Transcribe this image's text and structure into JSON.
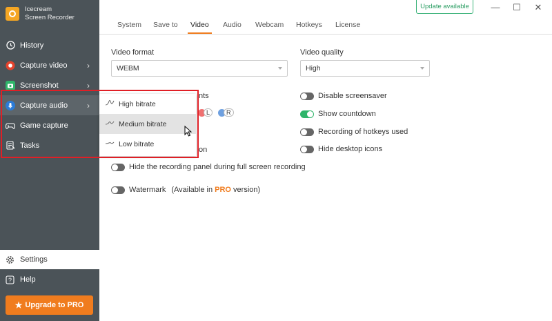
{
  "app": {
    "name_line1": "Icecream",
    "name_line2": "Screen Recorder"
  },
  "sidebar": {
    "items": [
      {
        "label": "History",
        "icon": "history-icon",
        "chevron": false
      },
      {
        "label": "Capture video",
        "icon": "record-icon",
        "chevron": true
      },
      {
        "label": "Screenshot",
        "icon": "camera-icon",
        "chevron": true
      },
      {
        "label": "Capture audio",
        "icon": "microphone-icon",
        "chevron": true
      },
      {
        "label": "Game capture",
        "icon": "gamepad-icon",
        "chevron": false
      },
      {
        "label": "Tasks",
        "icon": "tasks-icon",
        "chevron": false
      }
    ],
    "settings_label": "Settings",
    "help_label": "Help",
    "upgrade_label": "Upgrade to PRO"
  },
  "topbar": {
    "update_label": "Update available"
  },
  "tabs": [
    "System",
    "Save to",
    "Video",
    "Audio",
    "Webcam",
    "Hotkeys",
    "License"
  ],
  "active_tab": "Video",
  "video": {
    "format_label": "Video format",
    "format_value": "WEBM",
    "quality_label": "Video quality",
    "quality_value": "High",
    "partial_label_1": "nts",
    "partial_label_2": "on",
    "left_letter": "L",
    "right_letter": "R",
    "hide_panel_label": "Hide the recording panel during full screen recording",
    "watermark_label": "Watermark",
    "watermark_note_prefix": "(Available in ",
    "watermark_note_pro": "PRO",
    "watermark_note_suffix": " version)"
  },
  "right_toggles": [
    {
      "label": "Disable screensaver",
      "on": false
    },
    {
      "label": "Show countdown",
      "on": true
    },
    {
      "label": "Recording of hotkeys used",
      "on": false
    },
    {
      "label": "Hide desktop icons",
      "on": false
    }
  ],
  "audio_menu": {
    "items": [
      {
        "label": "High bitrate",
        "icon": "high-wave-icon"
      },
      {
        "label": "Medium bitrate",
        "icon": "medium-wave-icon"
      },
      {
        "label": "Low bitrate",
        "icon": "low-wave-icon"
      }
    ],
    "hovered": "Medium bitrate"
  },
  "colors": {
    "sidebar_bg": "#4b5358",
    "accent": "#f07c1e",
    "toggle_on": "#2fb56a",
    "highlight_border": "#e01f26",
    "update_green": "#2a9d62"
  }
}
